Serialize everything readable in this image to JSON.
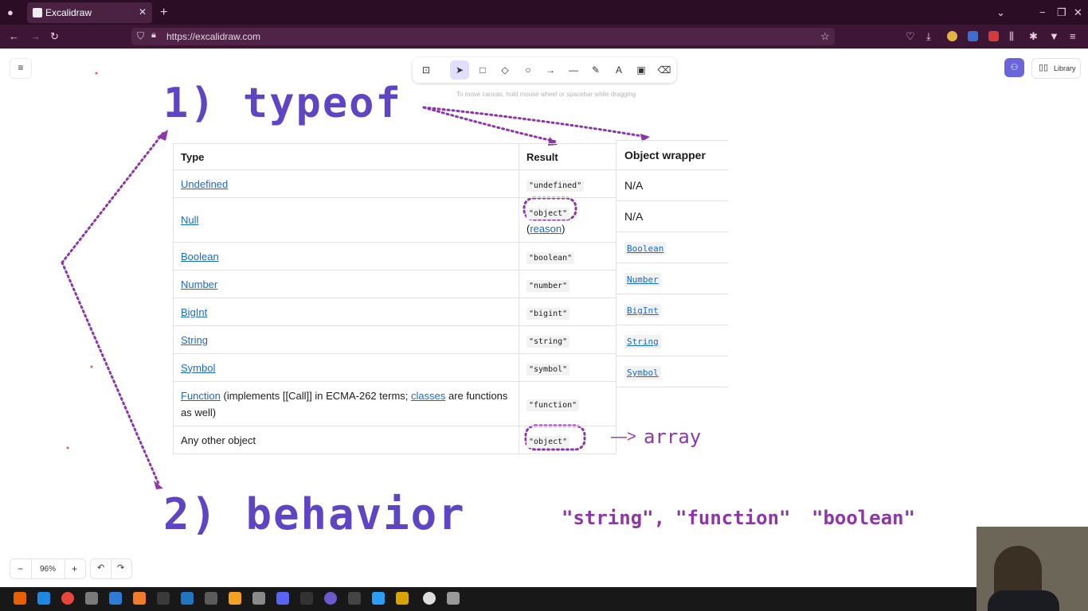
{
  "browser": {
    "tab_title": "Excalidraw",
    "tab_close": "✕",
    "new_tab": "+",
    "url": "https://excalidraw.com"
  },
  "canvas": {
    "hint": "To move canvas, hold mouse wheel or spacebar while dragging",
    "library_label": "Library",
    "zoom_level": "96%",
    "zoom_out": "−",
    "zoom_in": "+",
    "undo": "↶",
    "redo": "↷"
  },
  "drawing": {
    "heading1": "1) typeof",
    "heading2": "2) behavior",
    "array_label": "array",
    "array_arrow": "—>",
    "examples": [
      "\"string\",",
      "\"function\"",
      "\"boolean\""
    ]
  },
  "table": {
    "headers": [
      "Type",
      "Result"
    ],
    "rows": [
      {
        "type": "Undefined",
        "result": "\"undefined\""
      },
      {
        "type": "Null",
        "result": "\"object\"",
        "extra_open": "(",
        "extra_link": "reason",
        "extra_close": ")"
      },
      {
        "type": "Boolean",
        "result": "\"boolean\""
      },
      {
        "type": "Number",
        "result": "\"number\""
      },
      {
        "type": "BigInt",
        "result": "\"bigint\""
      },
      {
        "type": "String",
        "result": "\"string\""
      },
      {
        "type": "Symbol",
        "result": "\"symbol\""
      },
      {
        "type": "Function",
        "type_rest": " (implements [[Call]] in ECMA-262 terms; ",
        "type_link2": "classes",
        "type_rest2": " are functions as well)",
        "result": "\"function\""
      },
      {
        "type": "Any other object",
        "result": "\"object\""
      }
    ]
  },
  "wrapper_table": {
    "header": "Object wrapper",
    "rows": [
      "N/A",
      "N/A",
      "Boolean",
      "Number",
      "BigInt",
      "String",
      "Symbol"
    ]
  },
  "colors": {
    "heading": "#5f45c4",
    "annotation": "#8c37a8",
    "link": "#1a6ac3",
    "browser_bg": "#2b0e26"
  }
}
